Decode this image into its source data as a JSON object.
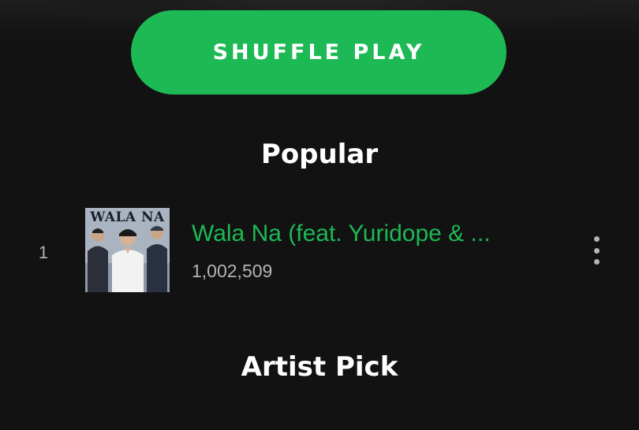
{
  "shuffle": {
    "label": "SHUFFLE PLAY"
  },
  "sections": {
    "popular": "Popular",
    "artist_pick": "Artist Pick"
  },
  "popular_tracks": [
    {
      "index": "1",
      "title": "Wala Na (feat. Yuridope & ...",
      "plays": "1,002,509",
      "cover_text": "WALA NA"
    }
  ],
  "colors": {
    "accent": "#1db954",
    "background": "#121212",
    "secondary_text": "#b3b3b3"
  },
  "icons": {
    "more": "vertical-ellipsis-icon"
  }
}
